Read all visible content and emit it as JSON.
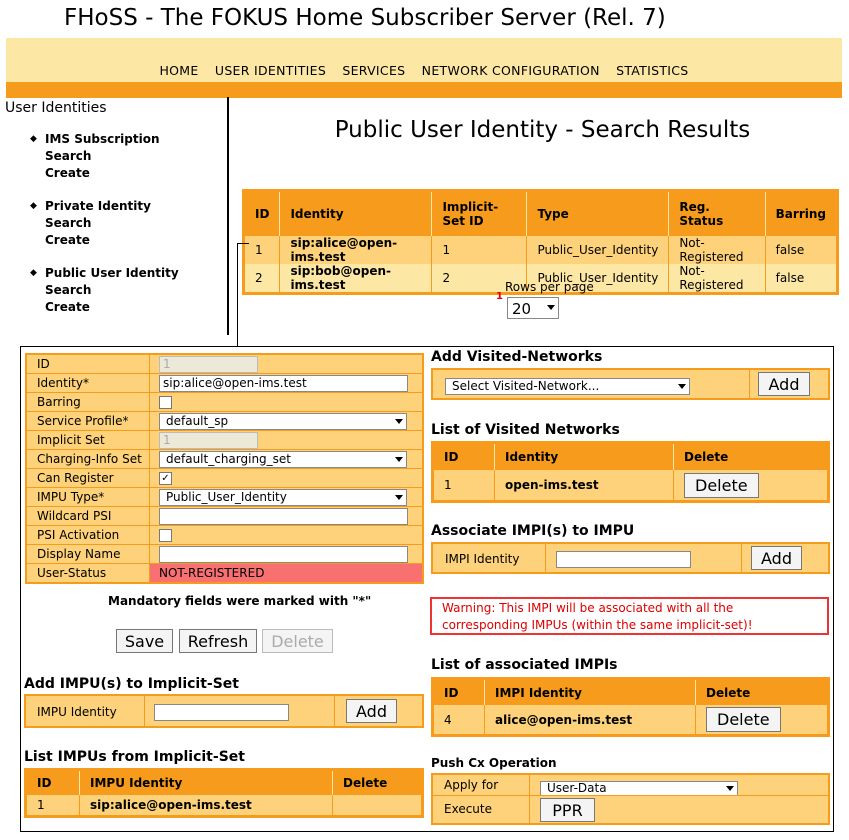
{
  "app": {
    "title": "FHoSS - The FOKUS Home Subscriber Server (Rel. 7)"
  },
  "nav": [
    "HOME",
    "USER IDENTITIES",
    "SERVICES",
    "NETWORK CONFIGURATION",
    "STATISTICS"
  ],
  "sidebar": {
    "title": "User Identities",
    "sections": [
      {
        "head": "IMS Subscription",
        "links": [
          "Search",
          "Create"
        ]
      },
      {
        "head": "Private Identity",
        "links": [
          "Search",
          "Create"
        ]
      },
      {
        "head": "Public User Identity",
        "links": [
          "Search",
          "Create"
        ]
      }
    ]
  },
  "results": {
    "title": "Public User Identity - Search Results",
    "headers": [
      "ID",
      "Identity",
      "Implicit-Set ID",
      "Type",
      "Reg. Status",
      "Barring"
    ],
    "rows": [
      [
        "1",
        "sip:alice@open-ims.test",
        "1",
        "Public_User_Identity",
        "Not-Registered",
        "false"
      ],
      [
        "2",
        "sip:bob@open-ims.test",
        "2",
        "Public_User_Identity",
        "Not-Registered",
        "false"
      ]
    ],
    "rows_per_page_label": "Rows per page",
    "rows_per_page_value": "20",
    "page_marker": "1"
  },
  "form": {
    "fields": {
      "id": {
        "label": "ID",
        "value": "1"
      },
      "identity": {
        "label": "Identity*",
        "value": "sip:alice@open-ims.test"
      },
      "barring": {
        "label": "Barring"
      },
      "service_profile": {
        "label": "Service Profile*",
        "value": "default_sp"
      },
      "implicit_set": {
        "label": "Implicit Set",
        "value": "1"
      },
      "charging": {
        "label": "Charging-Info Set",
        "value": "default_charging_set"
      },
      "can_register": {
        "label": "Can Register",
        "check": "✓"
      },
      "impu_type": {
        "label": "IMPU Type*",
        "value": "Public_User_Identity"
      },
      "wildcard": {
        "label": "Wildcard PSI",
        "value": ""
      },
      "psi_activation": {
        "label": "PSI Activation"
      },
      "display_name": {
        "label": "Display Name",
        "value": ""
      },
      "user_status": {
        "label": "User-Status",
        "value": "NOT-REGISTERED"
      }
    },
    "mandatory_note": "Mandatory fields were marked with \"*\"",
    "buttons": {
      "save": "Save",
      "refresh": "Refresh",
      "delete": "Delete"
    }
  },
  "add_impu": {
    "title": "Add IMPU(s) to Implicit-Set",
    "label": "IMPU Identity",
    "button": "Add"
  },
  "list_impus": {
    "title": "List IMPUs from Implicit-Set",
    "headers": [
      "ID",
      "IMPU Identity",
      "Delete"
    ],
    "rows": [
      [
        "1",
        "sip:alice@open-ims.test"
      ]
    ]
  },
  "add_visited": {
    "title": "Add Visited-Networks",
    "select": "Select Visited-Network...",
    "button": "Add"
  },
  "list_visited": {
    "title": "List of Visited Networks",
    "headers": [
      "ID",
      "Identity",
      "Delete"
    ],
    "rows": [
      [
        "1",
        "open-ims.test",
        "Delete"
      ]
    ]
  },
  "assoc_impi": {
    "title": "Associate IMPI(s) to IMPU",
    "label": "IMPI Identity",
    "button": "Add",
    "warning": "Warning: This IMPI will be associated with all the corresponding IMPUs (within the same implicit-set)!"
  },
  "list_impis": {
    "title": "List of associated IMPIs",
    "headers": [
      "ID",
      "IMPI Identity",
      "Delete"
    ],
    "rows": [
      [
        "4",
        "alice@open-ims.test",
        "Delete"
      ]
    ]
  },
  "push_cx": {
    "title": "Push Cx Operation",
    "apply_label": "Apply for",
    "apply_value": "User-Data",
    "execute_label": "Execute",
    "button": "PPR"
  }
}
